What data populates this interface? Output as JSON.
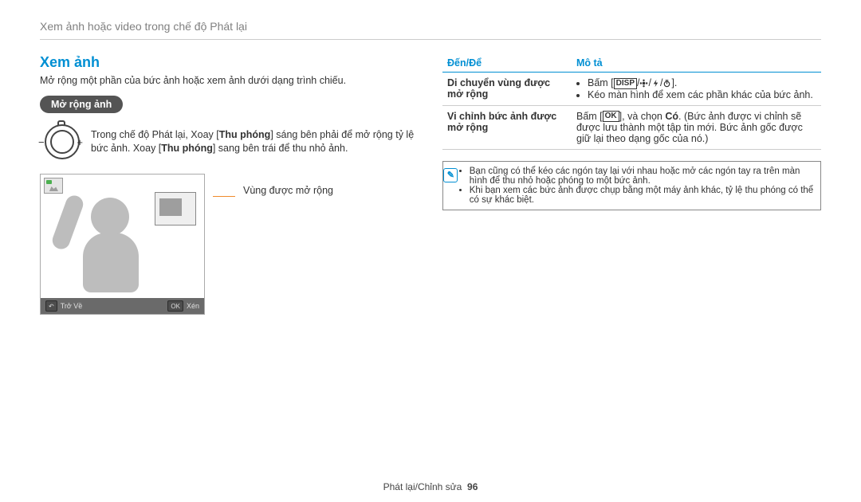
{
  "breadcrumb": "Xem ảnh hoặc video trong chế độ Phát lại",
  "section_title": "Xem ảnh",
  "intro": "Mở rộng một phần của bức ảnh hoặc xem ảnh dưới dạng trình chiếu.",
  "pill_label": "Mở rộng ảnh",
  "dial_text_pre": "Trong chế độ Phát lại, Xoay [",
  "dial_text_mid1": "Thu phóng",
  "dial_text_mid2": "] sáng bên phải để mở rộng tỷ lệ bức ảnh. Xoay [",
  "dial_text_mid3": "Thu phóng",
  "dial_text_post": "] sang bên trái để thu nhỏ ảnh.",
  "minus": "−",
  "plus": "+",
  "lcd_back_label": "Trở Về",
  "lcd_ok_label": "OK",
  "lcd_action_label": "Xén",
  "callout": "Vùng được mở rộng",
  "table": {
    "head_left": "Đến/Để",
    "head_right": "Mô tả",
    "r1_left": "Di chuyển vùng được mở rộng",
    "r1_b1_pre": "Bấm [",
    "r1_b1_disp": "DISP",
    "r1_b1_post": "].",
    "r1_b2": "Kéo màn hình để xem các phần khác của bức ảnh.",
    "r2_left": "Vi chỉnh bức ảnh được mở rộng",
    "r2_pre": "Bấm [",
    "r2_ok": "OK",
    "r2_mid": "], và chọn ",
    "r2_bold": "Có",
    "r2_post": ". (Bức ảnh được vi chỉnh sẽ được lưu thành một tập tin mới. Bức ảnh gốc được giữ lại theo dạng gốc của nó.)"
  },
  "note": {
    "n1": "Bạn cũng có thể kéo các ngón tay lại với nhau hoặc mở các ngón tay ra trên màn hình để thu nhỏ hoặc phóng to một bức ảnh.",
    "n2": "Khi bạn xem các bức ảnh được chụp bằng một máy ảnh khác, tỷ lệ thu phóng có thể có sự khác biệt."
  },
  "footer_section": "Phát lại/Chỉnh sửa",
  "footer_page": "96"
}
